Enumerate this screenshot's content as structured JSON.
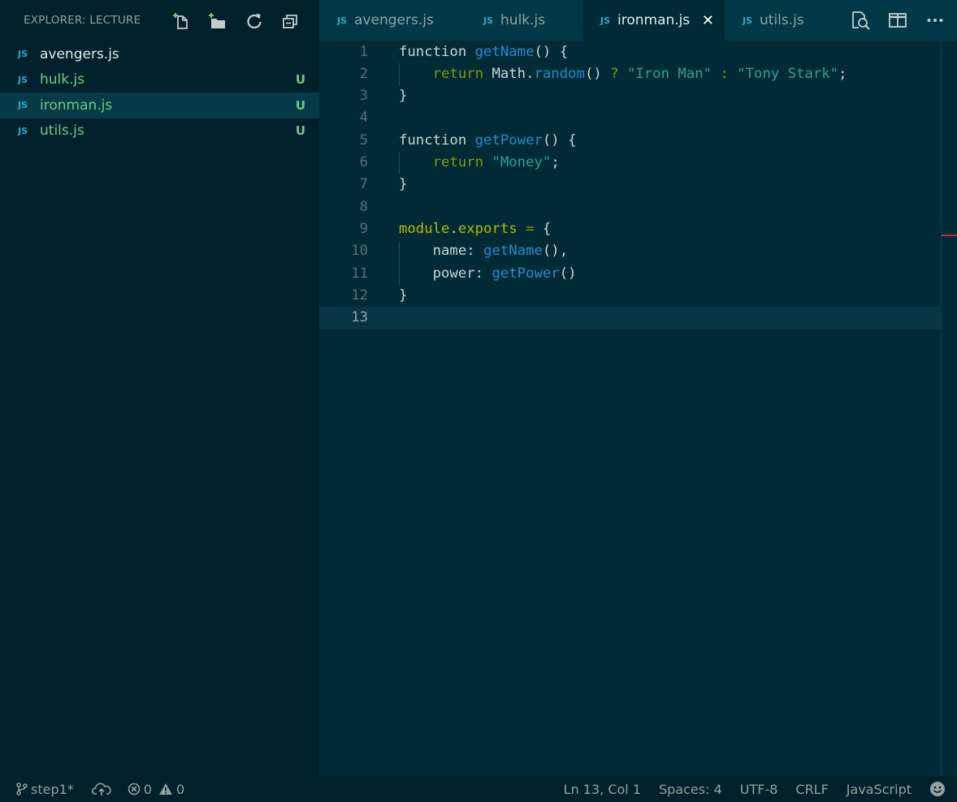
{
  "sidebar": {
    "title": "EXPLORER: LECTURE",
    "files": [
      {
        "tag": "JS",
        "name": "avengers.js",
        "badge": ""
      },
      {
        "tag": "JS",
        "name": "hulk.js",
        "badge": "U"
      },
      {
        "tag": "JS",
        "name": "ironman.js",
        "badge": "U"
      },
      {
        "tag": "JS",
        "name": "utils.js",
        "badge": "U"
      }
    ]
  },
  "tabs": [
    {
      "tag": "JS",
      "label": "avengers.js"
    },
    {
      "tag": "JS",
      "label": "hulk.js"
    },
    {
      "tag": "JS",
      "label": "ironman.js",
      "close": "✕"
    },
    {
      "tag": "JS",
      "label": "utils.js"
    }
  ],
  "editor": {
    "line_numbers": [
      "1",
      "2",
      "3",
      "4",
      "5",
      "6",
      "7",
      "8",
      "9",
      "10",
      "11",
      "12",
      "13"
    ],
    "lines": [
      [
        [
          "kw",
          "function "
        ],
        [
          "fn",
          "getName"
        ],
        [
          "plain",
          "() {"
        ]
      ],
      [
        [
          "plain",
          "    "
        ],
        [
          "ret",
          "return "
        ],
        [
          "plain",
          "Math."
        ],
        [
          "fn",
          "random"
        ],
        [
          "plain",
          "() "
        ],
        [
          "op",
          "? "
        ],
        [
          "str",
          "\"Iron Man\""
        ],
        [
          "op",
          " : "
        ],
        [
          "str",
          "\"Tony Stark\""
        ],
        [
          "plain",
          ";"
        ]
      ],
      [
        [
          "plain",
          "}"
        ]
      ],
      [],
      [
        [
          "kw",
          "function "
        ],
        [
          "fn",
          "getPower"
        ],
        [
          "plain",
          "() {"
        ]
      ],
      [
        [
          "plain",
          "    "
        ],
        [
          "ret",
          "return "
        ],
        [
          "str",
          "\"Money\""
        ],
        [
          "plain",
          ";"
        ]
      ],
      [
        [
          "plain",
          "}"
        ]
      ],
      [],
      [
        [
          "mod",
          "module"
        ],
        [
          "plain",
          "."
        ],
        [
          "mod",
          "exports"
        ],
        [
          "op",
          " = "
        ],
        [
          "plain",
          "{"
        ]
      ],
      [
        [
          "plain",
          "    name: "
        ],
        [
          "fn",
          "getName"
        ],
        [
          "plain",
          "(),"
        ]
      ],
      [
        [
          "plain",
          "    power: "
        ],
        [
          "fn",
          "getPower"
        ],
        [
          "plain",
          "()"
        ]
      ],
      [
        [
          "plain",
          "}"
        ]
      ],
      []
    ]
  },
  "status": {
    "branch": "step1*",
    "errors": "0",
    "warnings": "0",
    "position": "Ln 13, Col 1",
    "spaces": "Spaces: 4",
    "encoding": "UTF-8",
    "eol": "CRLF",
    "language": "JavaScript"
  }
}
